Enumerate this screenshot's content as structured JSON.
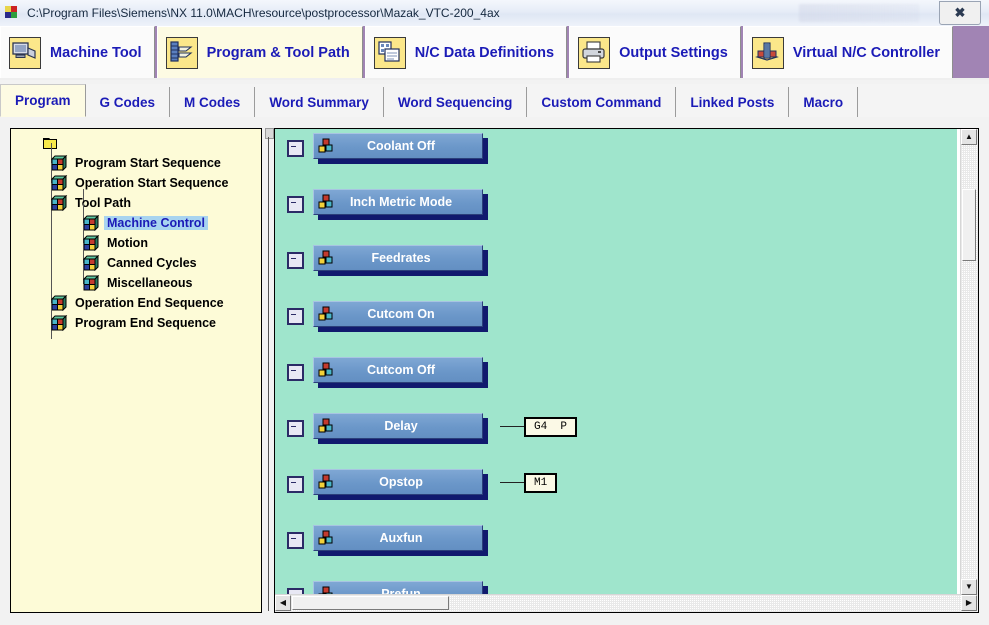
{
  "window": {
    "title": "C:\\Program Files\\Siemens\\NX 11.0\\MACH\\resource\\postprocessor\\Mazak_VTC-200_4ax",
    "app_icon": "app-icon",
    "close_label": "✖"
  },
  "ribbon": {
    "tabs": [
      {
        "label": "Machine Tool",
        "icon": "machine-tool-icon",
        "active": false
      },
      {
        "label": "Program & Tool Path",
        "icon": "program-tool-path-icon",
        "active": true
      },
      {
        "label": "N/C Data Definitions",
        "icon": "nc-data-definitions-icon",
        "active": false
      },
      {
        "label": "Output Settings",
        "icon": "printer-icon",
        "active": false
      },
      {
        "label": "Virtual N/C Controller",
        "icon": "virtual-nc-controller-icon",
        "active": false
      }
    ]
  },
  "subtabs": [
    {
      "label": "Program",
      "active": true
    },
    {
      "label": "G Codes",
      "active": false
    },
    {
      "label": "M Codes",
      "active": false
    },
    {
      "label": "Word Summary",
      "active": false
    },
    {
      "label": "Word Sequencing",
      "active": false
    },
    {
      "label": "Custom Command",
      "active": false
    },
    {
      "label": "Linked Posts",
      "active": false
    },
    {
      "label": "Macro",
      "active": false
    }
  ],
  "tree": {
    "root_icon": "folder-icon",
    "nodes": [
      {
        "label": "Program Start Sequence",
        "depth": 1,
        "selected": false
      },
      {
        "label": "Operation Start Sequence",
        "depth": 1,
        "selected": false
      },
      {
        "label": "Tool Path",
        "depth": 1,
        "selected": false
      },
      {
        "label": "Machine Control",
        "depth": 2,
        "selected": true
      },
      {
        "label": "Motion",
        "depth": 2,
        "selected": false
      },
      {
        "label": "Canned Cycles",
        "depth": 2,
        "selected": false
      },
      {
        "label": "Miscellaneous",
        "depth": 2,
        "selected": false
      },
      {
        "label": "Operation End Sequence",
        "depth": 1,
        "selected": false
      },
      {
        "label": "Program End Sequence",
        "depth": 1,
        "selected": false
      }
    ]
  },
  "canvas": {
    "background_color": "#9fe5cc",
    "block_color": "#6b97c9",
    "block_shadow_color": "#111a6e",
    "blocks": [
      {
        "label": "Coolant Off",
        "expander": "collapse",
        "code": null
      },
      {
        "label": "Inch Metric Mode",
        "expander": "collapse",
        "code": null
      },
      {
        "label": "Feedrates",
        "expander": "collapse",
        "code": null
      },
      {
        "label": "Cutcom On",
        "expander": "collapse",
        "code": null
      },
      {
        "label": "Cutcom Off",
        "expander": "collapse",
        "code": null
      },
      {
        "label": "Delay",
        "expander": "collapse",
        "code": "G4  P"
      },
      {
        "label": "Opstop",
        "expander": "collapse",
        "code": "M1"
      },
      {
        "label": "Auxfun",
        "expander": "collapse",
        "code": null
      },
      {
        "label": "Prefun",
        "expander": "collapse",
        "code": null
      }
    ]
  },
  "scrollbars": {
    "up_arrow": "▲",
    "down_arrow": "▼",
    "left_arrow": "◀",
    "right_arrow": "▶"
  }
}
